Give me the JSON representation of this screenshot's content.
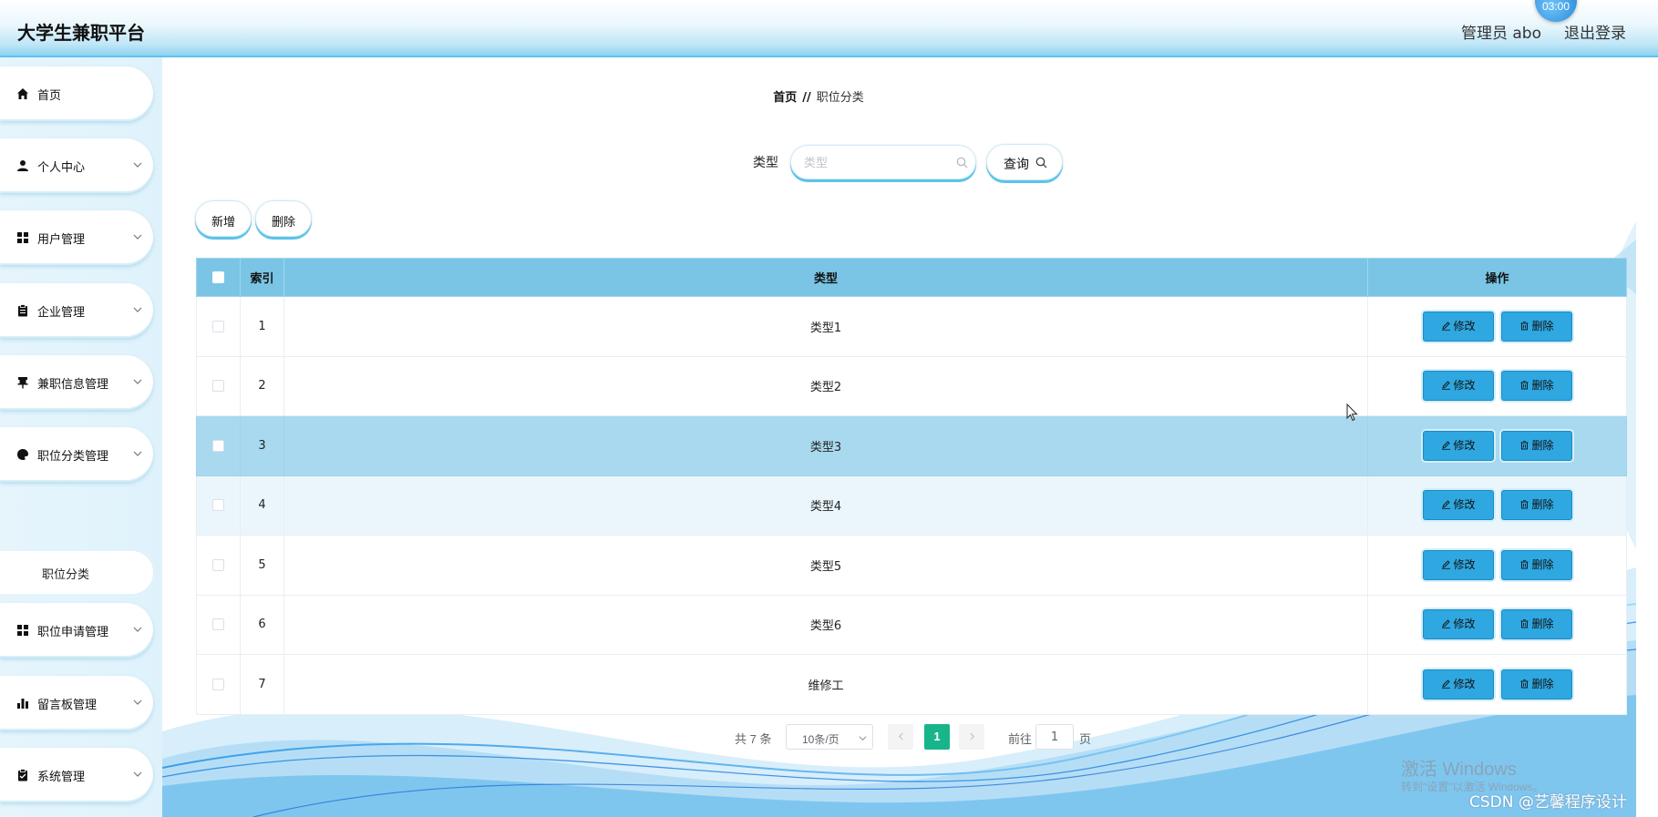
{
  "header": {
    "brand": "大学生兼职平台",
    "user": "管理员 abo",
    "logout": "退出登录",
    "timer": "03:00"
  },
  "sidebar": {
    "items": [
      {
        "label": "首页",
        "icon": "home-icon",
        "has_chevron": false
      },
      {
        "label": "个人中心",
        "icon": "user-icon",
        "has_chevron": true
      },
      {
        "label": "用户管理",
        "icon": "grid-icon",
        "has_chevron": true
      },
      {
        "label": "企业管理",
        "icon": "clipboard-icon",
        "has_chevron": true
      },
      {
        "label": "兼职信息管理",
        "icon": "pin-icon",
        "has_chevron": true
      },
      {
        "label": "职位分类管理",
        "icon": "palette-icon",
        "has_chevron": true
      },
      {
        "label": "职位申请管理",
        "icon": "grid-icon",
        "has_chevron": true
      },
      {
        "label": "留言板管理",
        "icon": "bar-chart-icon",
        "has_chevron": true
      },
      {
        "label": "系统管理",
        "icon": "checklist-icon",
        "has_chevron": true
      }
    ],
    "submenu": {
      "label": "职位分类"
    }
  },
  "breadcrumb": {
    "home": "首页",
    "separator": "//",
    "current": "职位分类"
  },
  "search": {
    "label": "类型",
    "placeholder": "类型",
    "value": "",
    "query_label": "查询"
  },
  "toolbar": {
    "add_label": "新增",
    "delete_label": "删除"
  },
  "table": {
    "headers": {
      "index": "索引",
      "type": "类型",
      "ops": "操作"
    },
    "rows": [
      {
        "index": "1",
        "type": "类型1"
      },
      {
        "index": "2",
        "type": "类型2"
      },
      {
        "index": "3",
        "type": "类型3"
      },
      {
        "index": "4",
        "type": "类型4"
      },
      {
        "index": "5",
        "type": "类型5"
      },
      {
        "index": "6",
        "type": "类型6"
      },
      {
        "index": "7",
        "type": "维修工"
      }
    ],
    "edit_label": "修改",
    "delete_label": "删除"
  },
  "pagination": {
    "total": "共 7 条",
    "page_size": "10条/页",
    "current": "1",
    "goto_label": "前往",
    "goto_value": "1",
    "page_unit": "页"
  },
  "watermarks": {
    "windows_line1": "激活 Windows",
    "windows_line2": "转到\"设置\"以激活 Windows。",
    "csdn": "CSDN @艺馨程序设计"
  },
  "colors": {
    "accent": "#5cc4ee",
    "table_header": "#7ac5e5",
    "op_button": "#2fa7e0",
    "page_active": "#18b58a"
  }
}
